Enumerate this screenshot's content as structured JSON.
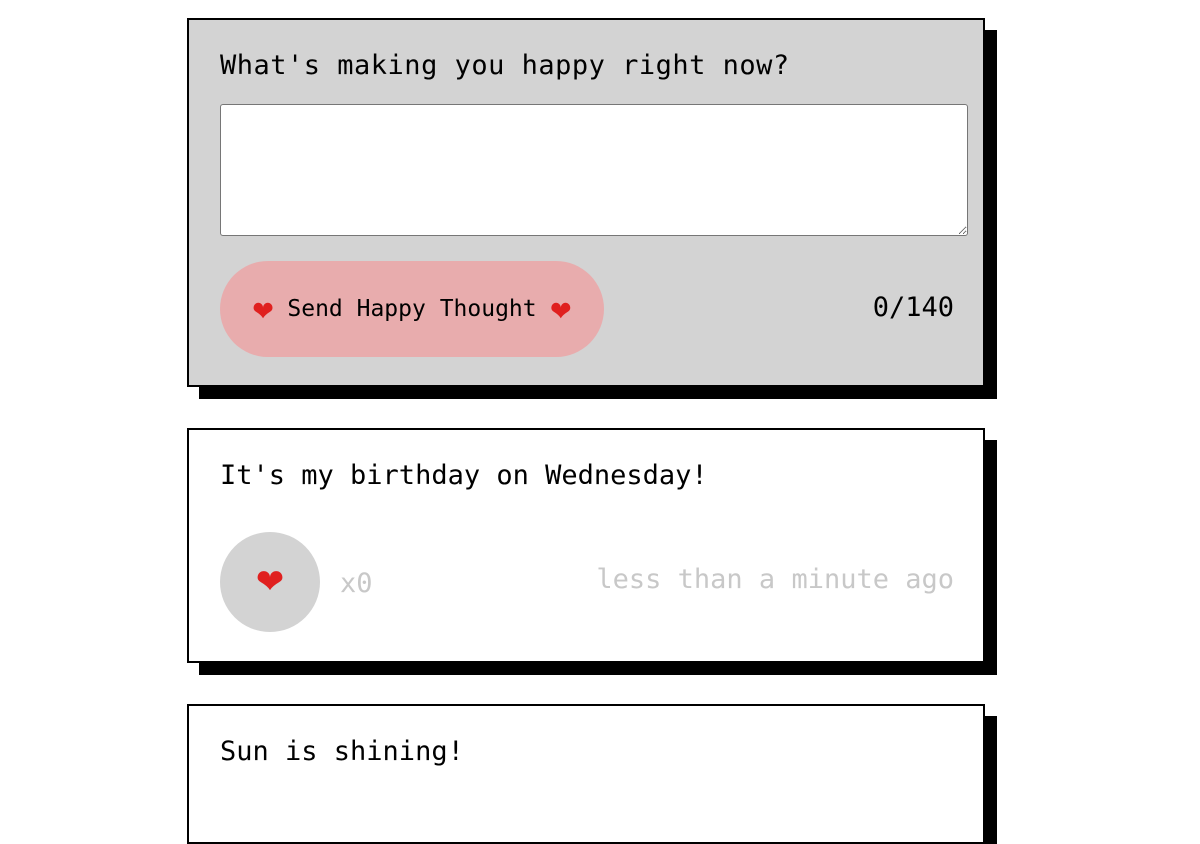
{
  "form": {
    "question": "What's making you happy right now?",
    "textarea_value": "",
    "button_label": "Send Happy Thought",
    "heart_glyph": "❤",
    "char_count": "0/140",
    "colors": {
      "card_background": "#d3d3d3",
      "button_background": "#e8acad"
    }
  },
  "thoughts": [
    {
      "message": "It's my birthday on Wednesday!",
      "heart_glyph": "❤",
      "likes": "x0",
      "time": "less than a minute ago"
    },
    {
      "message": "Sun is shining!"
    }
  ],
  "icons": {
    "heart": "heart-icon"
  }
}
